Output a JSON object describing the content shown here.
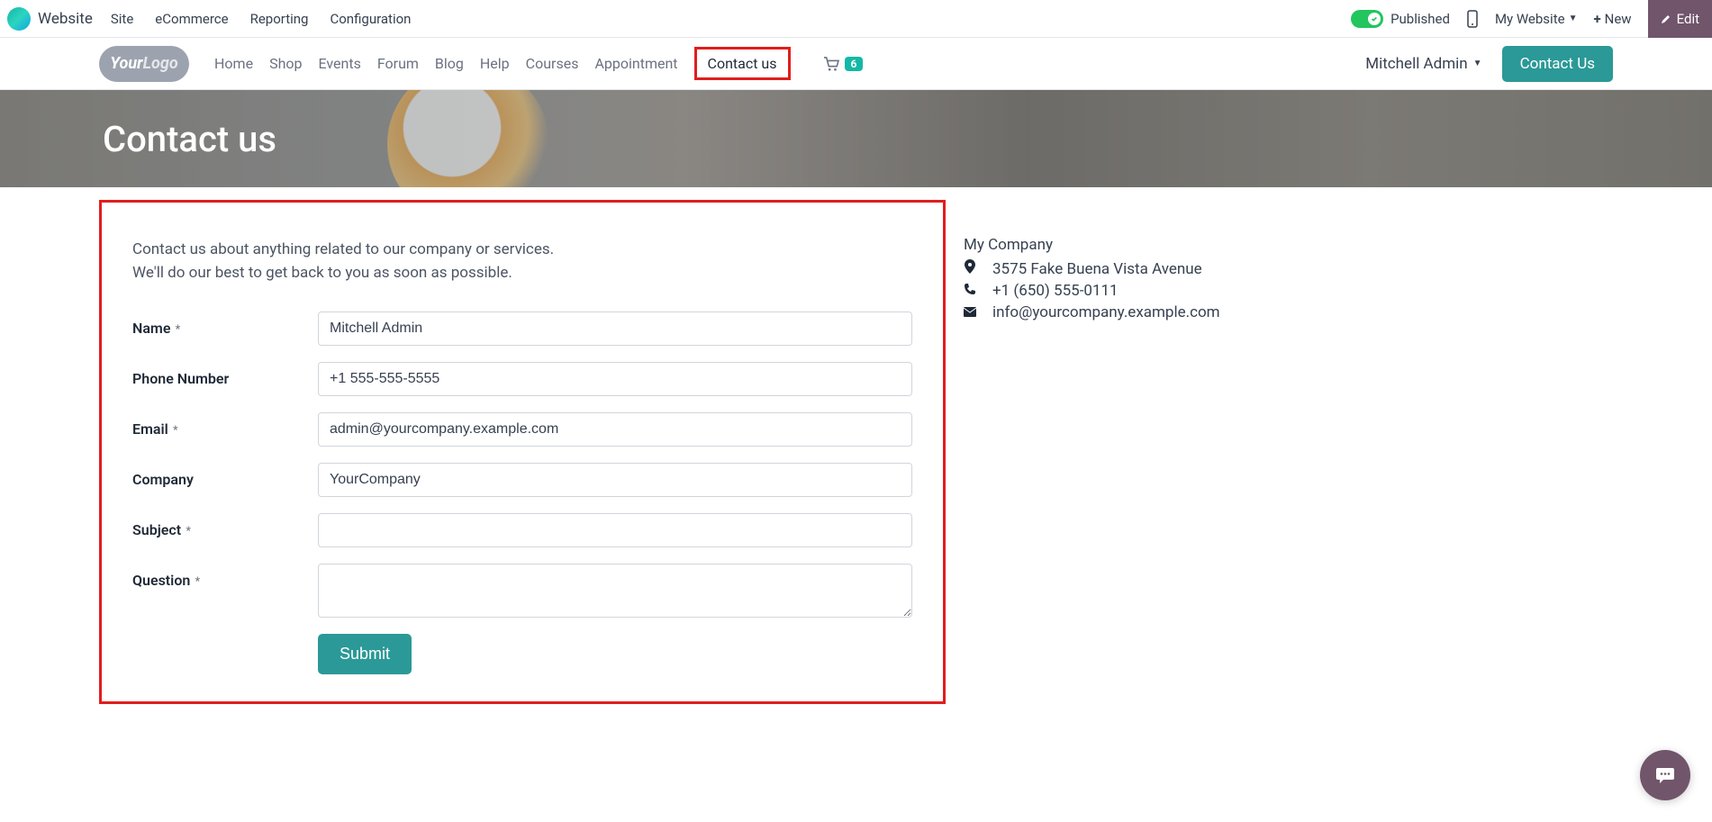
{
  "admin": {
    "title": "Website",
    "menu": [
      "Site",
      "eCommerce",
      "Reporting",
      "Configuration"
    ],
    "published": "Published",
    "my_website": "My Website",
    "new": "New",
    "edit": "Edit"
  },
  "site_nav": {
    "items": [
      "Home",
      "Shop",
      "Events",
      "Forum",
      "Blog",
      "Help",
      "Courses",
      "Appointment",
      "Contact us"
    ],
    "active_index": 8,
    "cart_count": "6",
    "user": "Mitchell Admin",
    "contact_btn": "Contact Us"
  },
  "hero": {
    "title": "Contact us"
  },
  "form": {
    "intro_line1": "Contact us about anything related to our company or services.",
    "intro_line2": "We'll do our best to get back to you as soon as possible.",
    "labels": {
      "name": "Name",
      "phone": "Phone Number",
      "email": "Email",
      "company": "Company",
      "subject": "Subject",
      "question": "Question"
    },
    "values": {
      "name": "Mitchell Admin",
      "phone": "+1 555-555-5555",
      "email": "admin@yourcompany.example.com",
      "company": "YourCompany",
      "subject": "",
      "question": ""
    },
    "submit": "Submit"
  },
  "company": {
    "name": "My Company",
    "address": "3575 Fake Buena Vista Avenue",
    "phone": "+1 (650) 555-0111",
    "email": "info@yourcompany.example.com"
  },
  "logo": {
    "your": "Your",
    "logo": "Logo"
  }
}
